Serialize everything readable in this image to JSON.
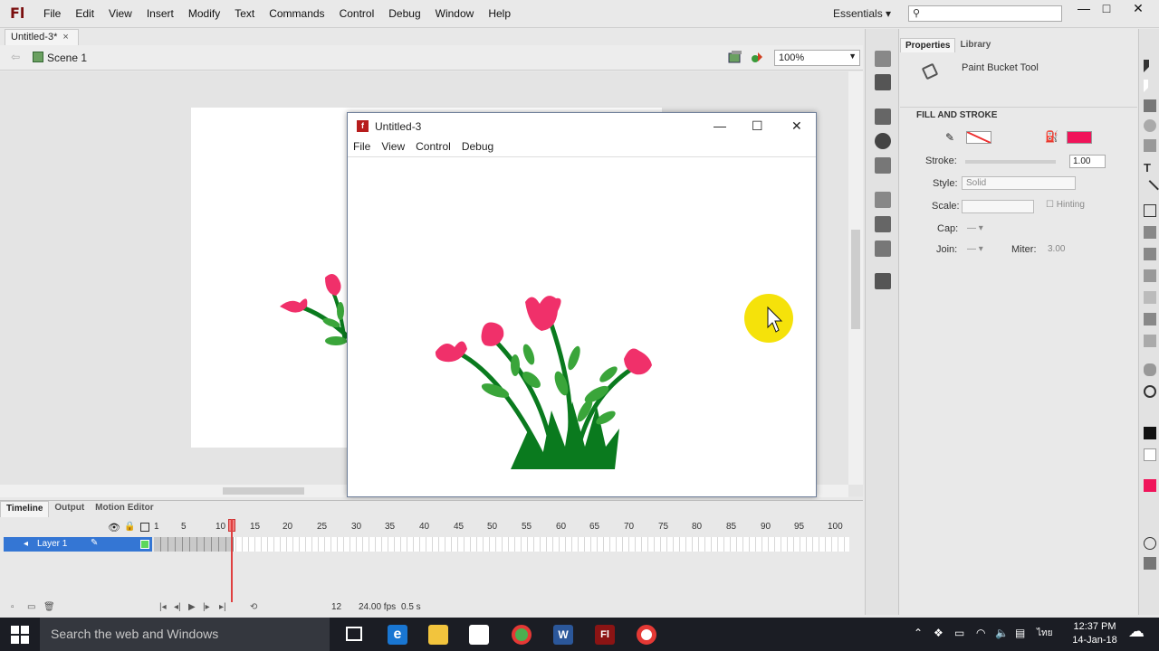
{
  "app": {
    "logo": "Fl",
    "menu": [
      "File",
      "Edit",
      "View",
      "Insert",
      "Modify",
      "Text",
      "Commands",
      "Control",
      "Debug",
      "Window",
      "Help"
    ],
    "workspace": "Essentials",
    "search_placeholder": ""
  },
  "document": {
    "tab_label": "Untitled-3*",
    "scene": "Scene 1",
    "zoom": "100%"
  },
  "player": {
    "title": "Untitled-3",
    "menu": [
      "File",
      "View",
      "Control",
      "Debug"
    ]
  },
  "timeline": {
    "tabs": [
      "Timeline",
      "Output",
      "Motion Editor"
    ],
    "layer": "Layer 1",
    "ruler": [
      "1",
      "5",
      "10",
      "15",
      "20",
      "25",
      "30",
      "35",
      "40",
      "45",
      "50",
      "55",
      "60",
      "65",
      "70",
      "75",
      "80",
      "85",
      "90",
      "95",
      "100"
    ],
    "current_frame": "12",
    "fps": "24.00 fps",
    "time": "0.5 s"
  },
  "properties": {
    "tabs": [
      "Properties",
      "Library"
    ],
    "tool_name": "Paint Bucket Tool",
    "section": "FILL AND STROKE",
    "stroke_label": "Stroke:",
    "stroke_value": "1.00",
    "style_label": "Style:",
    "style_value": "Solid",
    "scale_label": "Scale:",
    "hinting_label": "Hinting",
    "cap_label": "Cap:",
    "join_label": "Join:",
    "miter_label": "Miter:",
    "miter_value": "3.00",
    "fill_color": "#f0145a"
  },
  "taskbar": {
    "search": "Search the web and Windows",
    "time": "12:37 PM",
    "date": "14-Jan-18"
  },
  "colors": {
    "flower_pink": "#f0306a",
    "leaf_light": "#3aa53a",
    "leaf_dark": "#0a7a1e",
    "cursor_highlight": "#f5e20a"
  }
}
